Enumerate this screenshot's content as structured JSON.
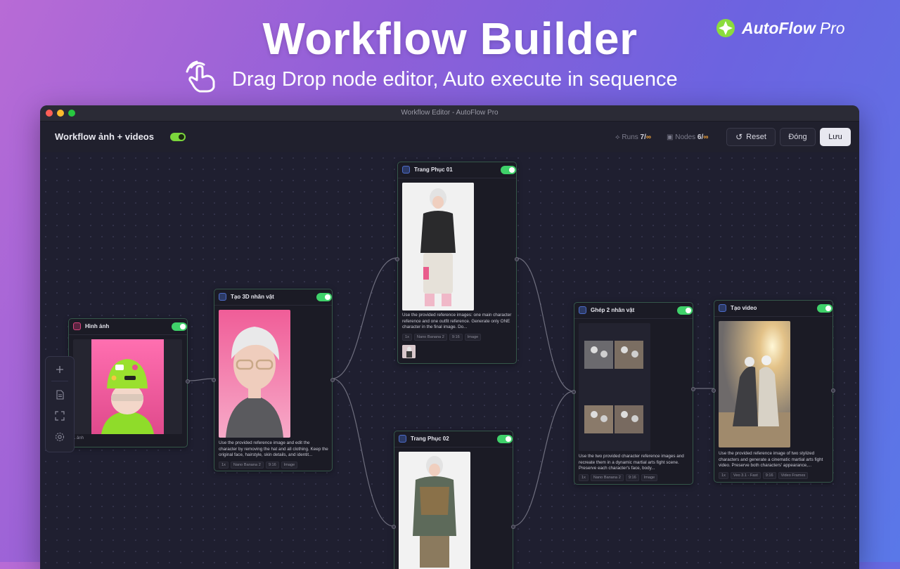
{
  "hero": {
    "title": "Workflow Builder",
    "subtitle": "Drag Drop node editor, Auto execute in sequence",
    "brand_name": "AutoFlow",
    "brand_suffix": "Pro"
  },
  "window": {
    "title": "Workflow Editor - AutoFlow Pro"
  },
  "toolbar": {
    "workflow_name": "Workflow ảnh + videos",
    "workflow_enabled": true,
    "runs_label": "Runs",
    "runs_value": "7/",
    "runs_limit": "∞",
    "nodes_label": "Nodes",
    "nodes_value": "6/",
    "nodes_limit": "∞",
    "reset_label": "Reset",
    "close_label": "Đóng",
    "save_label": "Lưu"
  },
  "side_tools": [
    "plus-icon",
    "document-icon",
    "fit-view-icon",
    "settings-icon"
  ],
  "nodes": {
    "image_input": {
      "title": "Hình ảnh",
      "enabled": true,
      "count_label": "1 ảnh"
    },
    "create_3d": {
      "title": "Tạo 3D nhân vật",
      "enabled": true,
      "prompt": "Use the provided reference image and edit the character by removing the hat and all clothing. Keep the original face, hairstyle, skin details, and identit...",
      "tags": [
        "1x",
        "Nano Banana 2",
        "9:16",
        "Image"
      ]
    },
    "outfit_01": {
      "title": "Trang Phục 01",
      "enabled": true,
      "prompt": "Use the provided reference images: one main character reference and one outfit reference. Generate only ONE character in the final image. Do...",
      "tags": [
        "1x",
        "Nano Banana 2",
        "9:16",
        "Image"
      ]
    },
    "outfit_02": {
      "title": "Trang Phục 02",
      "enabled": true
    },
    "merge_2": {
      "title": "Ghép 2 nhân vật",
      "enabled": true,
      "prompt": "Use the two provided character reference images and recreate them in a dynamic martial arts fight scene. Preserve each character's face, body...",
      "tags": [
        "1x",
        "Nano Banana 2",
        "9:16",
        "Image"
      ]
    },
    "create_video": {
      "title": "Tạo video",
      "enabled": true,
      "prompt": "Use the provided reference image of two stylized characters and generate a cinematic martial arts fight video. Preserve both characters' appearance,...",
      "tags": [
        "1x",
        "Veo 3.1 - Fast",
        "9:16",
        "Video Frames"
      ]
    }
  },
  "colors": {
    "accent_green": "#3fd16a",
    "workflow_toggle": "#7bd63c",
    "node_border": "#35574a",
    "infinity": "#f2a33a"
  }
}
